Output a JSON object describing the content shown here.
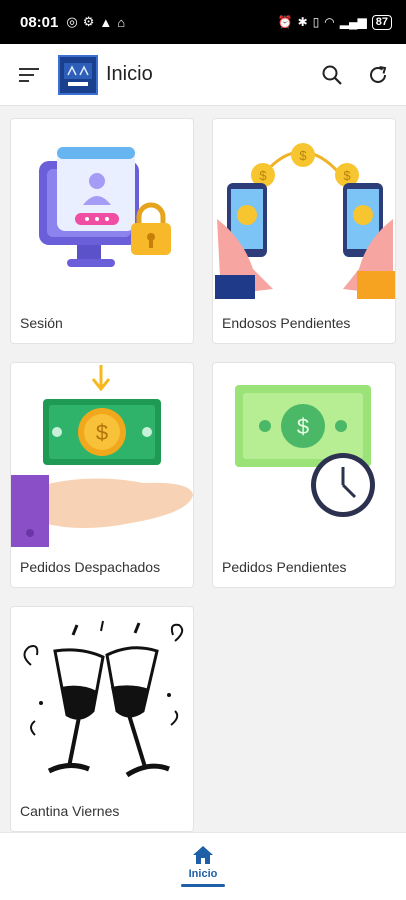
{
  "status_bar": {
    "time": "08:01",
    "battery": "87"
  },
  "app_bar": {
    "title": "Inicio"
  },
  "cards": [
    {
      "label": "Sesión"
    },
    {
      "label": "Endosos Pendientes"
    },
    {
      "label": "Pedidos Despachados"
    },
    {
      "label": "Pedidos Pendientes"
    },
    {
      "label": "Cantina Viernes"
    }
  ],
  "bottom_nav": {
    "home_label": "Inicio",
    "accent": "#1e5fa8"
  },
  "icons": [
    "menu-icon",
    "app-logo",
    "search-icon",
    "refresh-icon",
    "home-icon"
  ]
}
